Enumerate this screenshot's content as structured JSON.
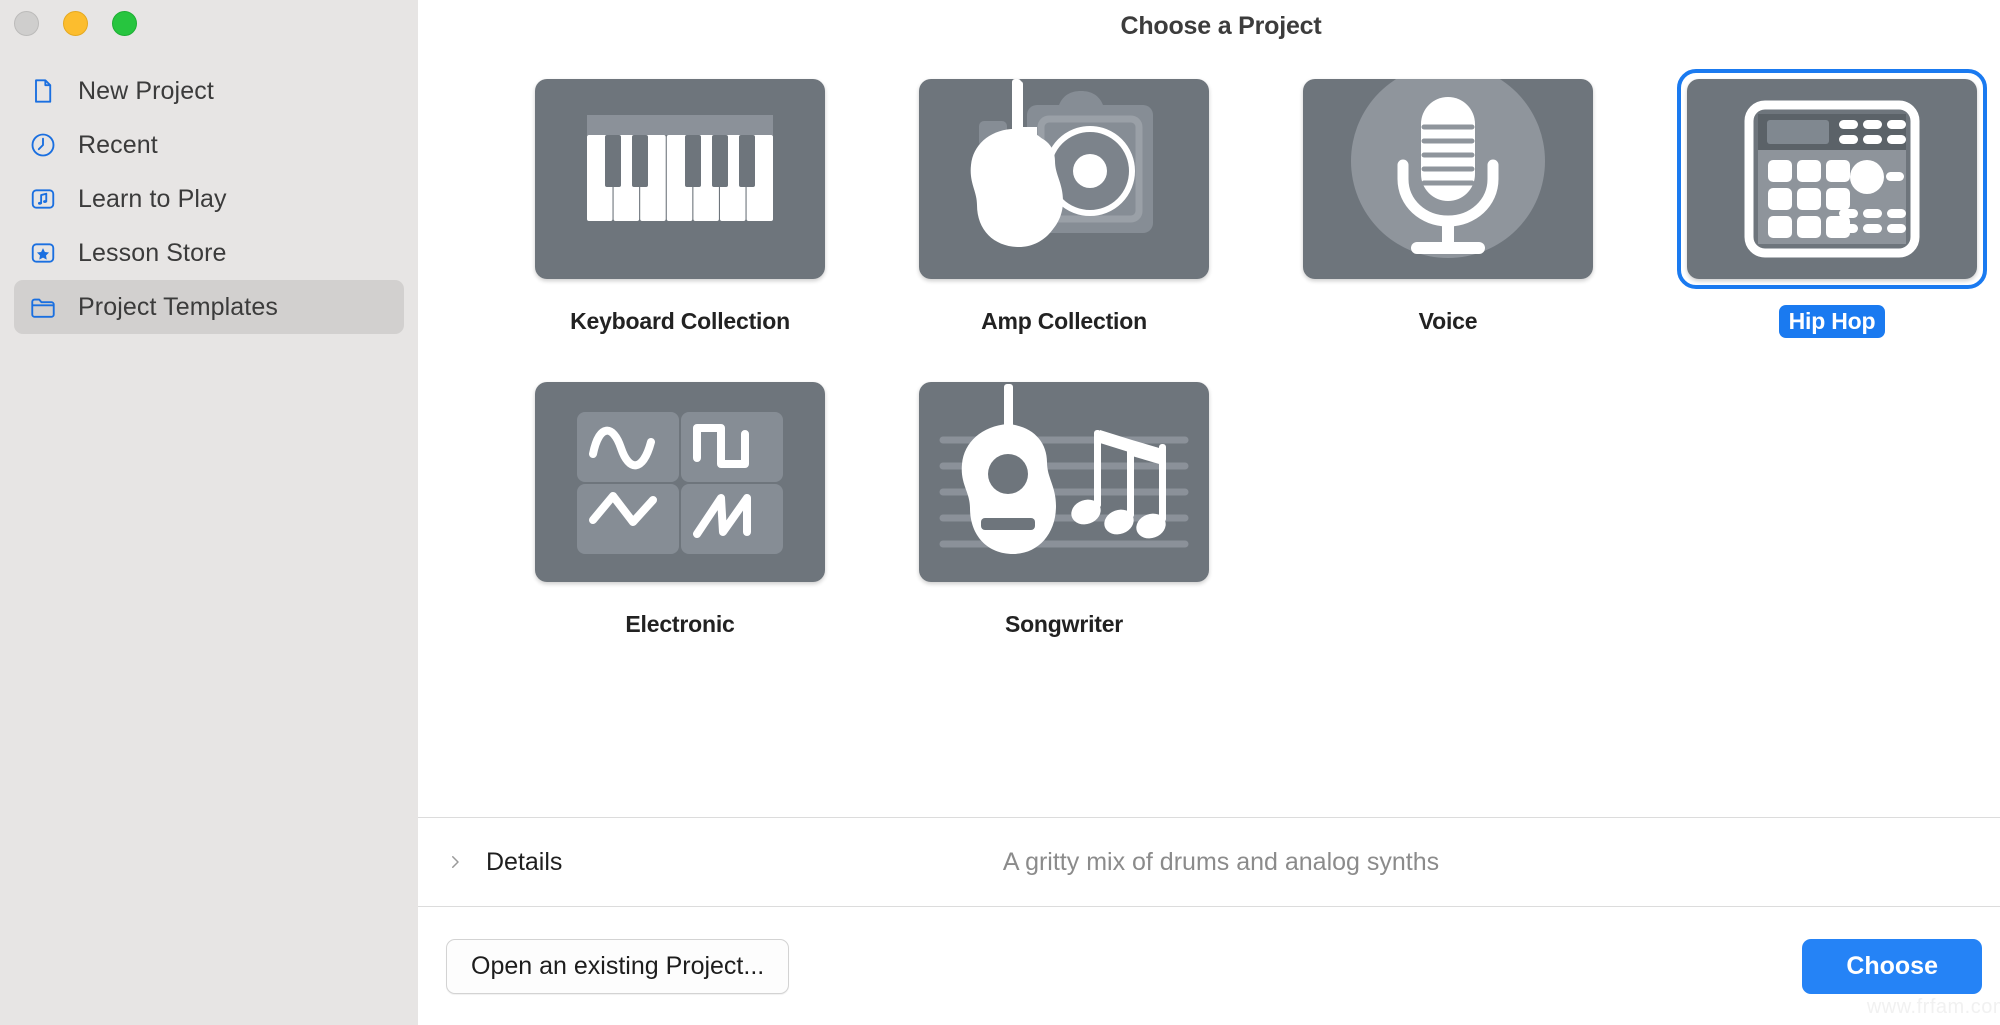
{
  "window": {
    "traffic_lights": [
      {
        "name": "close",
        "color": "#cfcecd"
      },
      {
        "name": "minimize",
        "color": "#fcbd2e"
      },
      {
        "name": "zoom",
        "color": "#27c53f"
      }
    ]
  },
  "sidebar": {
    "items": [
      {
        "label": "New Project",
        "icon": "document-icon",
        "selected": false
      },
      {
        "label": "Recent",
        "icon": "clock-icon",
        "selected": false
      },
      {
        "label": "Learn to Play",
        "icon": "music-note-icon",
        "selected": false
      },
      {
        "label": "Lesson Store",
        "icon": "star-icon",
        "selected": false
      },
      {
        "label": "Project Templates",
        "icon": "folder-icon",
        "selected": true
      }
    ]
  },
  "main": {
    "title": "Choose a Project",
    "tiles": [
      {
        "label": "Keyboard Collection",
        "icon": "piano-keyboard-icon",
        "selected": false
      },
      {
        "label": "Amp Collection",
        "icon": "electric-guitar-amp-icon",
        "selected": false
      },
      {
        "label": "Voice",
        "icon": "microphone-icon",
        "selected": false
      },
      {
        "label": "Hip Hop",
        "icon": "drum-machine-icon",
        "selected": true
      },
      {
        "label": "Electronic",
        "icon": "waveforms-icon",
        "selected": false
      },
      {
        "label": "Songwriter",
        "icon": "acoustic-guitar-notes-icon",
        "selected": false
      }
    ]
  },
  "details": {
    "label": "Details",
    "description": "A gritty mix of drums and analog synths",
    "expanded": false
  },
  "footer": {
    "open_label": "Open an existing Project...",
    "choose_label": "Choose"
  },
  "watermark": "www.frfam.com",
  "colors": {
    "accent": "#1a7af0",
    "choose_button": "#2583f6",
    "sidebar_bg": "#e7e5e4",
    "tile_bg": "#6e757c",
    "tile_inner": "#8b9199",
    "selection_row": "#d2d0cf"
  }
}
